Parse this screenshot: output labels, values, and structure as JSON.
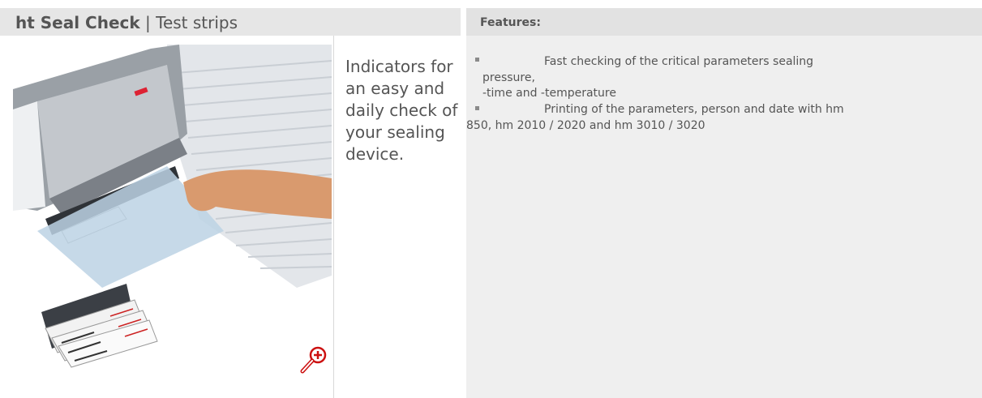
{
  "header": {
    "brand": "ht Seal Check",
    "separator": " | ",
    "subtitle": "Test strips"
  },
  "description": "Indicators for an easy and daily check of your sealing device.",
  "features": {
    "heading": "Features:",
    "items": [
      {
        "line1": "Fast checking of the critical parameters sealing",
        "line2": "pressure,",
        "line3": "-time and -temperature"
      },
      {
        "line1": "Printing of the parameters, person and date with hm",
        "line2": "850, hm 2010 / 2020 and hm 3010 / 3020"
      }
    ]
  },
  "icons": {
    "zoom": "zoom-in-icon",
    "bullet": "square-bullet"
  },
  "colors": {
    "header_bg": "#e6e6e6",
    "panel_bg": "#efefef",
    "text": "#555555",
    "zoom_icon": "#cc1111"
  }
}
